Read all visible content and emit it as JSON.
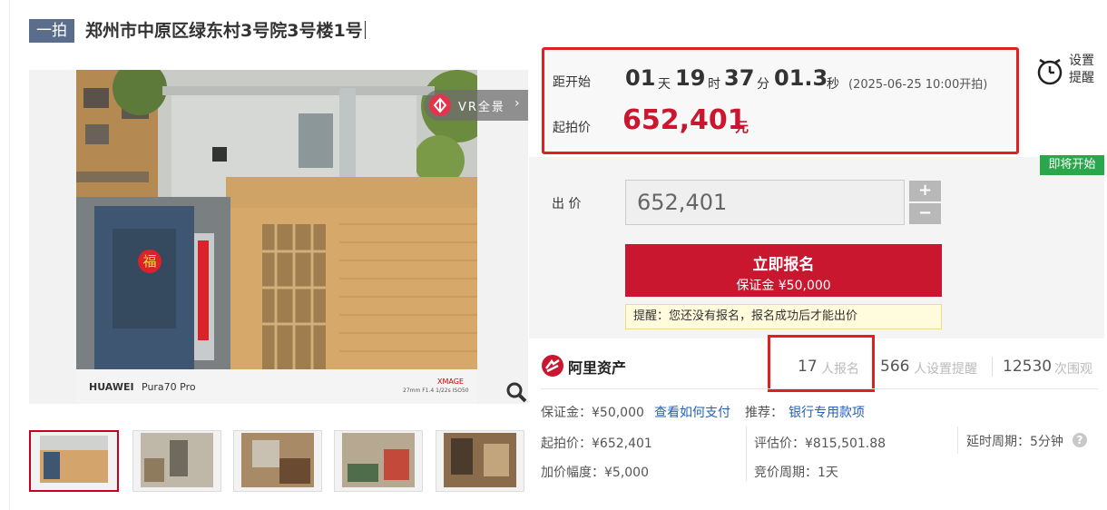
{
  "header": {
    "tag": "一拍",
    "title": "郑州市中原区绿东村3号院3号楼1号"
  },
  "gallery": {
    "vr_label": "VR全景",
    "watermark_brand": "HUAWEI",
    "watermark_model": "Pura70 Pro",
    "watermark_xmage": "XMAGE",
    "watermark_params": "27mm  F1.4  1/22s  ISO50",
    "door_char": "福"
  },
  "countdown": {
    "label": "距开始",
    "days": "01",
    "days_unit": "天",
    "hours": "19",
    "hours_unit": "时",
    "minutes": "37",
    "minutes_unit": "分",
    "seconds": "01.3",
    "seconds_unit": "秒",
    "start_note": "(2025-06-25 10:00开拍)"
  },
  "starting_price": {
    "label": "起拍价",
    "value": "652,401",
    "unit": "元"
  },
  "reminder": {
    "line1": "设置",
    "line2": "提醒"
  },
  "status_badge": "即将开始",
  "bid": {
    "label": "出 价",
    "value": "652,401",
    "plus": "+",
    "minus": "−"
  },
  "apply_button": {
    "line1": "立即报名",
    "line2": "保证金 ¥50,000"
  },
  "tip": "提醒：您还没有报名，报名成功后才能出价",
  "platform": {
    "name": "阿里资产"
  },
  "stats": {
    "signup_count": "17",
    "signup_label": "人报名",
    "reminder_count": "566",
    "reminder_label": "人设置提醒",
    "views_count": "12530",
    "views_label": "次围观"
  },
  "details": {
    "deposit_label": "保证金：¥50,000",
    "pay_link": "查看如何支付",
    "recommend_label": "推荐：",
    "recommend_link": "银行专用款项",
    "start_price": "起拍价：¥652,401",
    "appraisal": "评估价：¥815,501.88",
    "delay": "延时周期：5分钟",
    "increment": "加价幅度：¥5,000",
    "bid_period": "竞价周期：1天"
  },
  "colors": {
    "accent": "#c8172f",
    "badge": "#2aa64b",
    "tag": "#5b6d8c",
    "link": "#2361b8"
  }
}
